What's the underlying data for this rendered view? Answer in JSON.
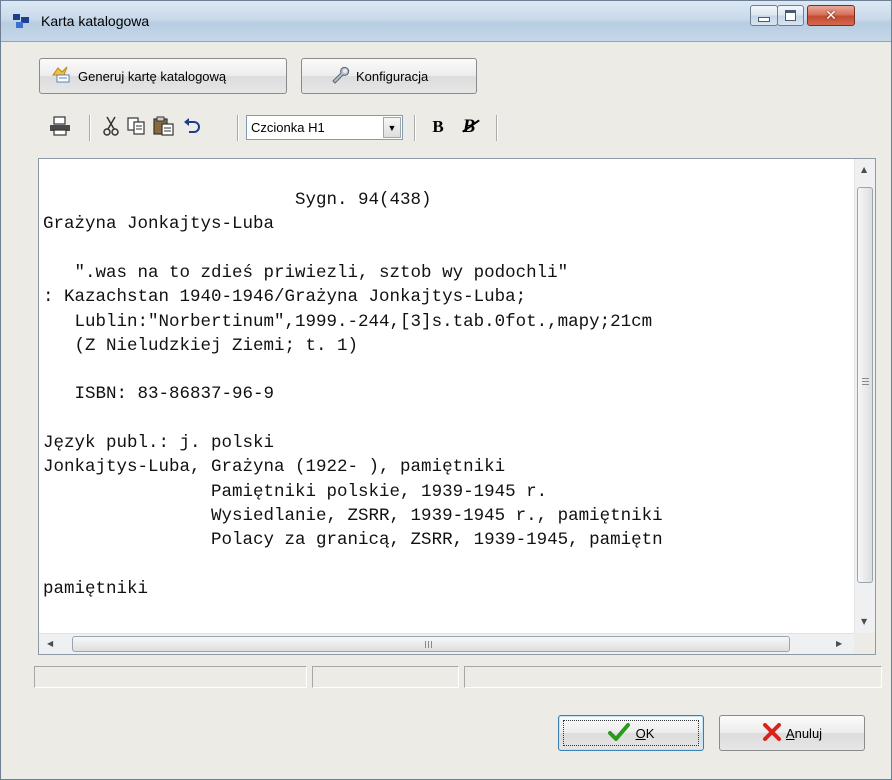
{
  "window": {
    "title": "Karta katalogowa",
    "controls": {
      "minimize": "minimize",
      "maximize": "maximize",
      "close": "✕"
    }
  },
  "action_buttons": {
    "generate_label": "Generuj kartę katalogową",
    "config_label": "Konfiguracja"
  },
  "toolbar": {
    "font_combo_value": "Czcionka H1",
    "bold_label": "B",
    "clear_bold_label": "B"
  },
  "document": {
    "lines": [
      "                        Sygn. 94(438)",
      "Grażyna Jonkajtys-Luba",
      "",
      "   \".was na to zdieś priwiezli, sztob wy podochli\"",
      ": Kazachstan 1940-1946/Grażyna Jonkajtys-Luba;",
      "   Lublin:\"Norbertinum\",1999.-244,[3]s.tab.0fot.,mapy;21cm",
      "   (Z Nieludzkiej Ziemi; t. 1)",
      "",
      "   ISBN: 83-86837-96-9",
      "",
      "Język publ.: j. polski",
      "Jonkajtys-Luba, Grażyna (1922- ), pamiętniki",
      "                Pamiętniki polskie, 1939-1945 r.",
      "                Wysiedlanie, ZSRR, 1939-1945 r., pamiętniki",
      "                Polacy za granicą, ZSRR, 1939-1945, pamiętn",
      "",
      "pamiętniki"
    ]
  },
  "footer": {
    "ok_label": "OK",
    "ok_mnemonic": "O",
    "ok_rest": "K",
    "cancel_label": "Anuluj",
    "cancel_mnemonic": "A",
    "cancel_rest": "nuluj"
  },
  "colors": {
    "ok_check": "#2a9a1c",
    "cancel_x": "#d9241a",
    "titlebar": "#c9d9ea"
  },
  "icons": [
    "app-icon",
    "magic-wand-icon",
    "wrench-icon",
    "print-icon",
    "cut-icon",
    "copy-icon",
    "paste-icon",
    "undo-icon"
  ]
}
